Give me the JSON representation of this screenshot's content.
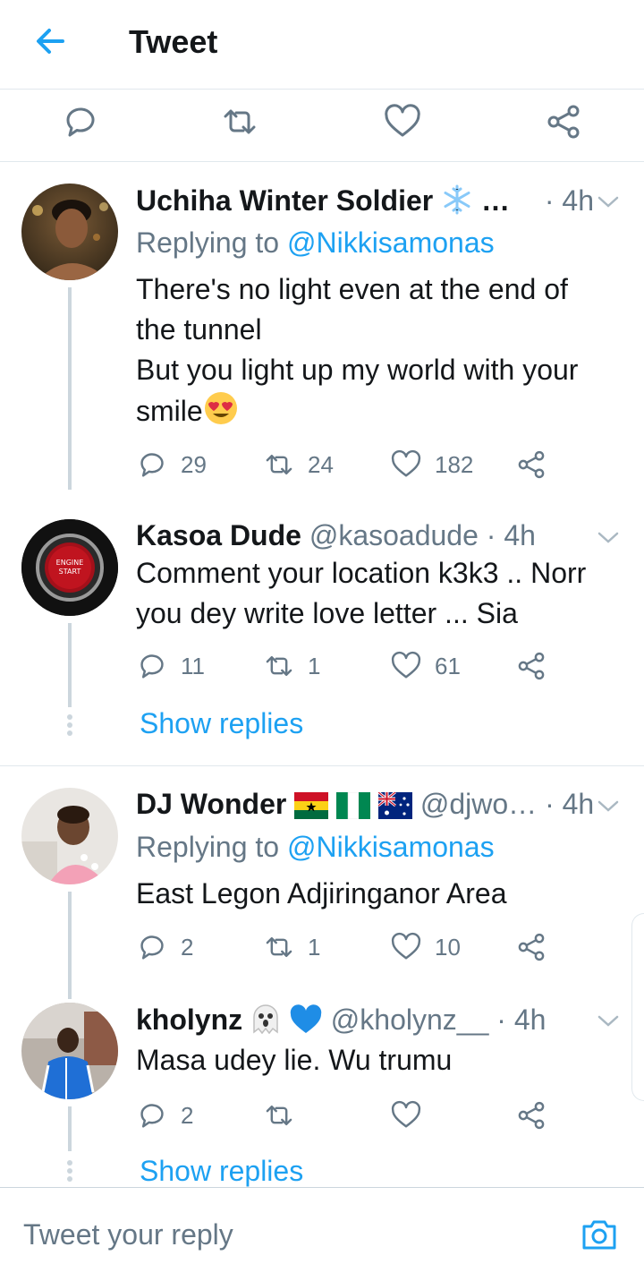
{
  "header": {
    "title": "Tweet"
  },
  "colors": {
    "accent": "#1da1f2",
    "muted": "#657786",
    "text": "#14171a",
    "divider": "#e1e8ed"
  },
  "main_actions": [
    {
      "icon": "reply-icon"
    },
    {
      "icon": "retweet-icon"
    },
    {
      "icon": "like-icon"
    },
    {
      "icon": "share-icon"
    }
  ],
  "tweets": [
    {
      "name": "Uchiha Winter Soldier",
      "name_suffix": "…",
      "handle": "",
      "sep": "·",
      "time": "4h",
      "replying_prefix": "Replying to",
      "replying_to": "@Nikkisamonas",
      "text_lines": [
        "There's no light even at the end of",
        "the tunnel",
        "But you light up my world with your",
        "smile"
      ],
      "replies": "29",
      "retweets": "24",
      "likes": "182"
    },
    {
      "name": "Kasoa Dude",
      "handle": "@kasoadude",
      "sep": "·",
      "time": "4h",
      "avatar_text": [
        "ENGINE",
        "START"
      ],
      "text_lines": [
        "Comment your location k3k3 .. Norr",
        "you dey write love letter ... Sia"
      ],
      "replies": "11",
      "retweets": "1",
      "likes": "61"
    },
    {
      "name": "DJ Wonder",
      "handle": "@djwo…",
      "sep": "·",
      "time": "4h",
      "replying_prefix": "Replying to",
      "replying_to": "@Nikkisamonas",
      "text_lines": [
        "East Legon Adjiringanor Area"
      ],
      "replies": "2",
      "retweets": "1",
      "likes": "10"
    },
    {
      "name": "kholynz",
      "handle": "@kholynz__",
      "sep": "·",
      "time": "4h",
      "text_lines": [
        "Masa udey lie. Wu trumu"
      ],
      "replies": "2",
      "retweets": "",
      "likes": ""
    }
  ],
  "show_replies_label": "Show replies",
  "compose": {
    "placeholder": "Tweet your reply"
  }
}
